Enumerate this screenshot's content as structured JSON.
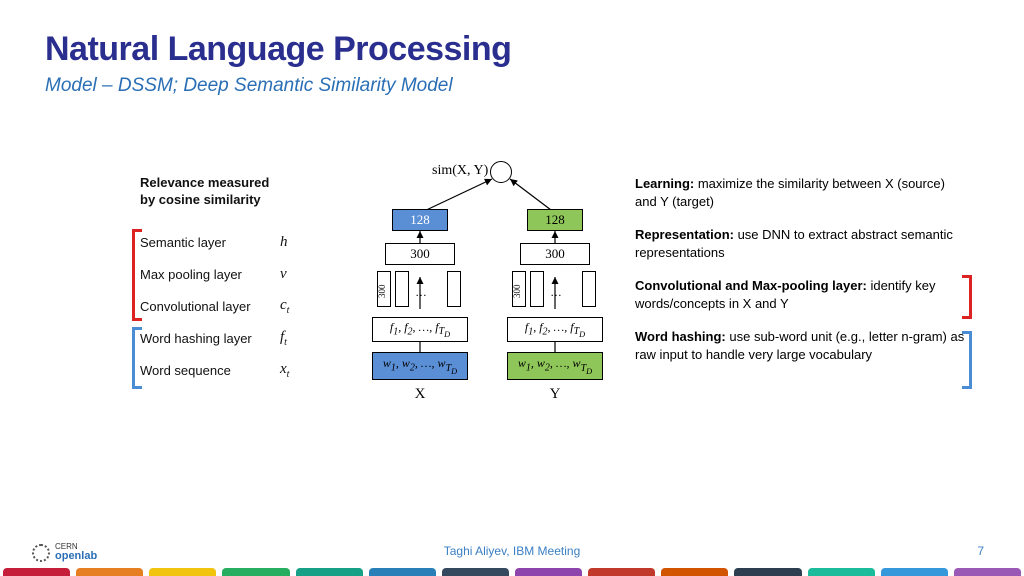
{
  "title": "Natural Language Processing",
  "subtitle": "Model – DSSM; Deep Semantic Similarity Model",
  "cosine_label": "Relevance measured\nby cosine similarity",
  "layers": {
    "semantic": {
      "name": "Semantic layer",
      "sym": "h"
    },
    "maxpool": {
      "name": "Max pooling layer",
      "sym": "v"
    },
    "conv": {
      "name": "Convolutional layer",
      "sym": "c",
      "sub": "t"
    },
    "hash": {
      "name": "Word hashing layer",
      "sym": "f",
      "sub": "t"
    },
    "seq": {
      "name": "Word sequence",
      "sym": "x",
      "sub": "t"
    }
  },
  "net": {
    "sim_label": "sim(X, Y)",
    "v128": "128",
    "v300": "300",
    "pill": "300",
    "dots": "…",
    "fX": "f₁, f₂, …, f_{T_D}",
    "fY": "f₁, f₂, …, f_{T_D}",
    "wX": "w₁, w₂, …, w_{T_D}",
    "wY": "w₁, w₂, …, w_{T_D}",
    "axisX": "X",
    "axisY": "Y"
  },
  "desc": {
    "learning_b": "Learning:",
    "learning": " maximize the similarity between X (source) and Y (target)",
    "repr_b": "Representation:",
    "repr": " use DNN to extract abstract semantic representations",
    "conv_b": "Convolutional and Max-pooling layer:",
    "conv": " identify key words/concepts in X and Y",
    "hash_b": "Word hashing:",
    "hash": " use sub-word unit (e.g., letter n-gram) as raw input to handle very large vocabulary"
  },
  "footer": {
    "author": "Taghi Aliyev, IBM Meeting",
    "page": "7",
    "logo_top": "CERN",
    "logo_bottom": "openlab"
  },
  "ribbon_colors": [
    "#c41e3a",
    "#e67e22",
    "#f1c40f",
    "#27ae60",
    "#16a085",
    "#2980b9",
    "#34495e",
    "#8e44ad",
    "#c0392b",
    "#d35400",
    "#2c3e50",
    "#1abc9c",
    "#3498db",
    "#9b59b6"
  ]
}
